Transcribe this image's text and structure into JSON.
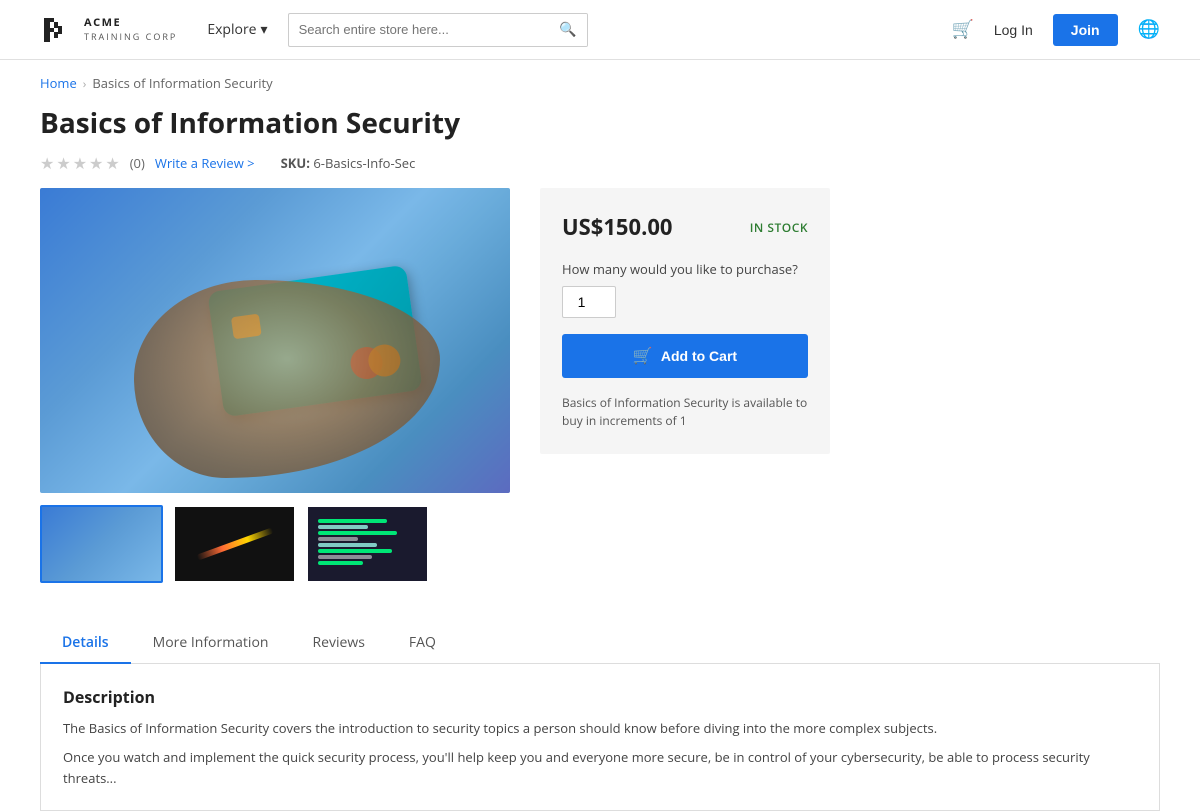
{
  "header": {
    "logo_line1": "ACME",
    "logo_line2": "TRAINING CORP",
    "explore_label": "Explore",
    "search_placeholder": "Search entire store here...",
    "login_label": "Log In",
    "join_label": "Join"
  },
  "breadcrumb": {
    "home": "Home",
    "current": "Basics of Information Security"
  },
  "product": {
    "title": "Basics of Information Security",
    "rating_count": "(0)",
    "review_link": "Write a Review >",
    "sku_label": "SKU:",
    "sku_value": "6-Basics-Info-Sec",
    "price": "US$150.00",
    "stock_status": "IN STOCK",
    "qty_label": "How many would you like to purchase?",
    "qty_value": "1",
    "add_to_cart_label": "Add to Cart",
    "availability_note": "Basics of Information Security is available to buy in increments of 1"
  },
  "tabs": [
    {
      "id": "details",
      "label": "Details",
      "active": true
    },
    {
      "id": "more-info",
      "label": "More Information",
      "active": false
    },
    {
      "id": "reviews",
      "label": "Reviews",
      "active": false
    },
    {
      "id": "faq",
      "label": "FAQ",
      "active": false
    }
  ],
  "description": {
    "title": "Description",
    "text1": "The Basics of Information Security covers the introduction to security topics a person should know before diving into the more complex subjects.",
    "text2": "Once you watch and implement the quick security process, you'll help keep you and everyone more secure, be in control of your cybersecurity, be able to process security threats..."
  }
}
